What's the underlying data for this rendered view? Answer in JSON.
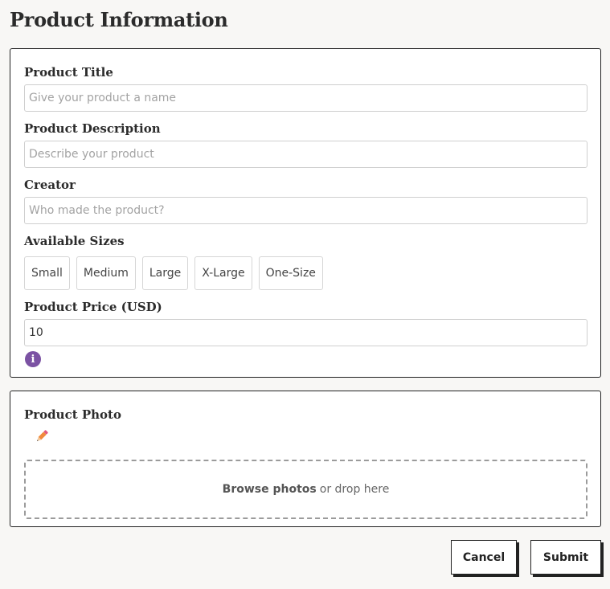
{
  "page": {
    "title": "Product Information"
  },
  "form": {
    "title_label": "Product Title",
    "title_placeholder": "Give your product a name",
    "description_label": "Product Description",
    "description_placeholder": "Describe your product",
    "creator_label": "Creator",
    "creator_placeholder": "Who made the product?",
    "sizes_label": "Available Sizes",
    "sizes": [
      "Small",
      "Medium",
      "Large",
      "X-Large",
      "One-Size"
    ],
    "price_label": "Product Price (USD)",
    "price_value": "10",
    "info_icon": "i"
  },
  "photo": {
    "label": "Product Photo",
    "edit_icon": "pencil-icon",
    "browse_text": "Browse photos",
    "drop_text": "or drop here"
  },
  "actions": {
    "cancel": "Cancel",
    "submit": "Submit"
  },
  "colors": {
    "accent": "#7b52a3",
    "pencil": "#f08a3c"
  }
}
